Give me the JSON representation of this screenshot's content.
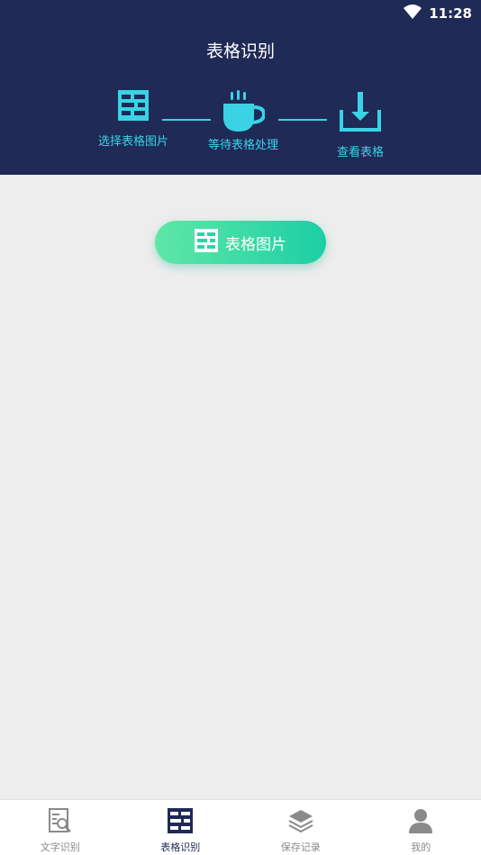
{
  "status_bar": {
    "time": "11:28",
    "wifi_icon": "wifi-icon"
  },
  "header": {
    "title": "表格识别"
  },
  "steps": [
    {
      "label": "选择表格图片",
      "icon": "table-icon"
    },
    {
      "label": "等待表格处理",
      "icon": "coffee-cup-icon"
    },
    {
      "label": "查看表格",
      "icon": "download-icon"
    }
  ],
  "main_button": {
    "label": "表格图片",
    "icon": "table-icon"
  },
  "tabbar": {
    "items": [
      {
        "label": "文字识别",
        "icon": "document-search-icon",
        "active": false
      },
      {
        "label": "表格识别",
        "icon": "table-icon",
        "active": true
      },
      {
        "label": "保存记录",
        "icon": "layers-icon",
        "active": false
      },
      {
        "label": "我的",
        "icon": "user-icon",
        "active": false
      }
    ]
  },
  "colors": {
    "header_bg": "#1f2a56",
    "accent": "#3ad3e6",
    "button_start": "#5fe7a6",
    "button_end": "#1ccfa5",
    "background": "#ededed"
  }
}
